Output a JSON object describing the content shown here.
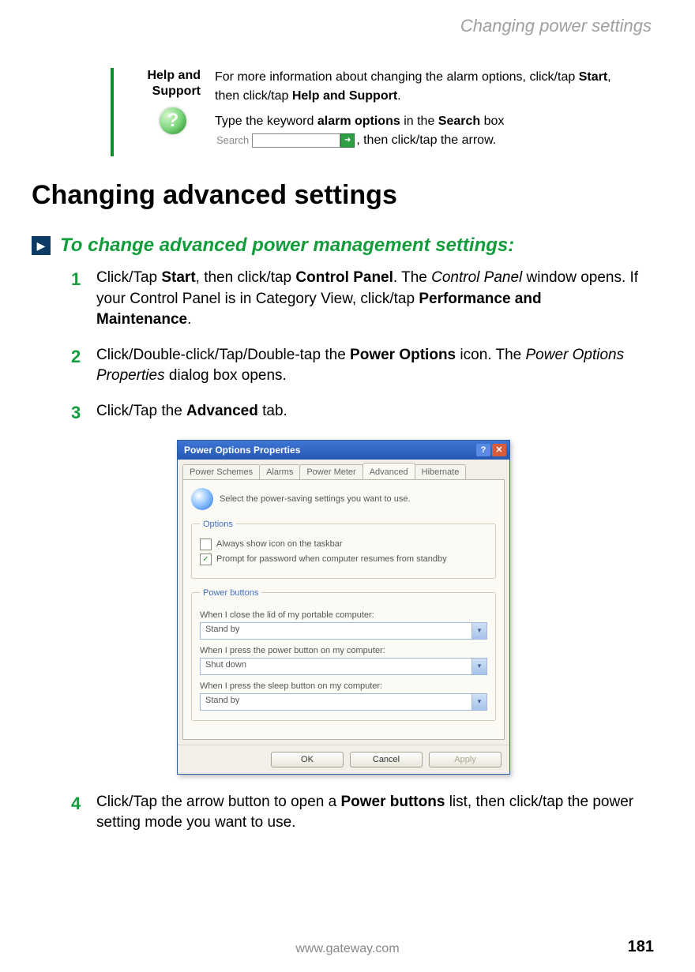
{
  "running_head": "Changing power settings",
  "help": {
    "label_line1": "Help and",
    "label_line2": "Support",
    "icon_glyph": "?",
    "p1_a": "For more information about changing the alarm options, click/tap ",
    "p1_b": "Start",
    "p1_c": ", then click/tap ",
    "p1_d": "Help and Support",
    "p1_e": ".",
    "p2_a": "Type the keyword ",
    "p2_b": "alarm options",
    "p2_c": " in the ",
    "p2_d": "Search",
    "p2_e": " box ",
    "p2_f": ", then click/tap the arrow.",
    "search_label": "Search",
    "search_go": "➜"
  },
  "section_heading": "Changing advanced settings",
  "procedure_title": "To change advanced power management settings:",
  "proc_arrow_glyph": "▶",
  "steps": {
    "s1": {
      "num": "1",
      "a": "Click/Tap ",
      "b": "Start",
      "c": ", then click/tap ",
      "d": "Control Panel",
      "e": ". The ",
      "f": "Control Panel",
      "g": " window opens. If your Control Panel is in Category View, click/tap ",
      "h": "Performance and Maintenance",
      "i": "."
    },
    "s2": {
      "num": "2",
      "a": "Click/Double-click/Tap/Double-tap the ",
      "b": "Power Options",
      "c": " icon. The ",
      "d": "Power Options Properties",
      "e": " dialog box opens."
    },
    "s3": {
      "num": "3",
      "a": "Click/Tap the ",
      "b": "Advanced",
      "c": " tab."
    },
    "s4": {
      "num": "4",
      "a": "Click/Tap the arrow button to open a ",
      "b": "Power buttons",
      "c": " list, then click/tap the power setting mode you want to use."
    }
  },
  "dialog": {
    "title": "Power Options Properties",
    "help_btn": "?",
    "close_btn": "✕",
    "tabs": [
      "Power Schemes",
      "Alarms",
      "Power Meter",
      "Advanced",
      "Hibernate"
    ],
    "active_tab_index": 3,
    "panel_text": "Select the power-saving settings you want to use.",
    "group_options": {
      "legend": "Options",
      "chk1": {
        "checked": false,
        "label": "Always show icon on the taskbar"
      },
      "chk2": {
        "checked": true,
        "label": "Prompt for password when computer resumes from standby"
      }
    },
    "group_power": {
      "legend": "Power buttons",
      "f1_label": "When I close the lid of my portable computer:",
      "f1_value": "Stand by",
      "f2_label": "When I press the power button on my computer:",
      "f2_value": "Shut down",
      "f3_label": "When I press the sleep button on my computer:",
      "f3_value": "Stand by"
    },
    "buttons": {
      "ok": "OK",
      "cancel": "Cancel",
      "apply": "Apply"
    }
  },
  "footer": {
    "url": "www.gateway.com",
    "page": "181"
  }
}
